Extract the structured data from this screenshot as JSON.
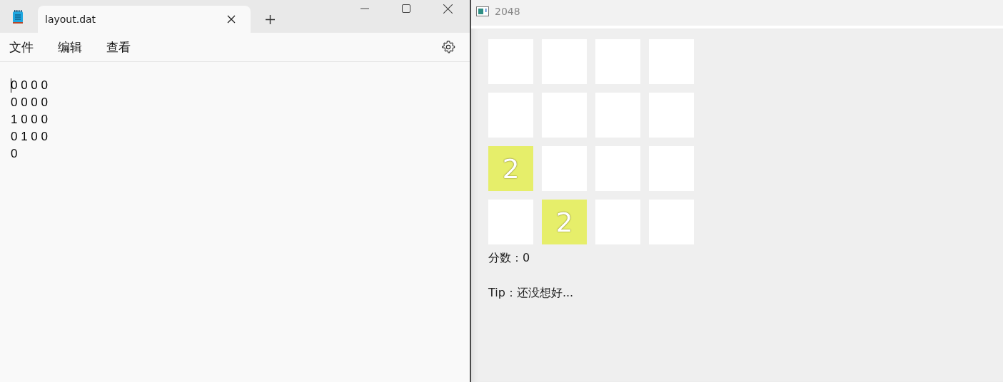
{
  "notepad": {
    "tab_title": "layout.dat",
    "menu": [
      "文件",
      "编辑",
      "查看"
    ],
    "lines": [
      "0 0 0 0",
      "0 0 0 0",
      "1 0 0 0",
      "0 1 0 0",
      "0"
    ]
  },
  "game": {
    "title": "2048",
    "board": [
      [
        {
          "kind": "empty"
        },
        {
          "kind": "empty"
        },
        {
          "kind": "empty"
        },
        {
          "kind": "empty"
        }
      ],
      [
        {
          "kind": "empty"
        },
        {
          "kind": "empty"
        },
        {
          "kind": "empty"
        },
        {
          "kind": "empty"
        }
      ],
      [
        {
          "kind": "tile",
          "value": "2"
        },
        {
          "kind": "empty"
        },
        {
          "kind": "empty"
        },
        {
          "kind": "empty"
        }
      ],
      [
        {
          "kind": "empty"
        },
        {
          "kind": "tile",
          "value": "2"
        },
        {
          "kind": "empty"
        },
        {
          "kind": "empty"
        }
      ]
    ],
    "score": "分数：0",
    "tip": "Tip：还没想好..."
  }
}
